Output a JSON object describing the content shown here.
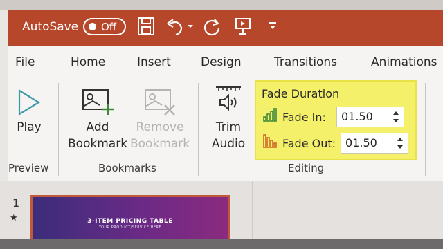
{
  "titlebar": {
    "autosave_label": "AutoSave",
    "autosave_state": "Off"
  },
  "tabs": [
    "File",
    "Home",
    "Insert",
    "Design",
    "Transitions",
    "Animations"
  ],
  "groups": {
    "preview": {
      "label": "Preview",
      "play_label": "Play"
    },
    "bookmarks": {
      "label": "Bookmarks",
      "add_line1": "Add",
      "add_line2": "Bookmark",
      "remove_line1": "Remove",
      "remove_line2": "Bookmark"
    },
    "editing": {
      "label": "Editing",
      "trim_line1": "Trim",
      "trim_line2": "Audio",
      "fade_title": "Fade Duration",
      "fade_in_label": "Fade In:",
      "fade_in_value": "01.50",
      "fade_out_label": "Fade Out:",
      "fade_out_value": "01.50"
    }
  },
  "slides": {
    "number": "1",
    "star": "★",
    "thumb_title": "3-ITEM PRICING TABLE",
    "thumb_subtitle": "YOUR PRODUCT/SERVICE HERE"
  },
  "colors": {
    "titlebar": "#b7472a",
    "highlight": "#f5f06a",
    "fade_icon_green": "#3f8a3a",
    "fade_icon_orange": "#d0662a",
    "slide_gradient_start": "#3b2d7a",
    "slide_gradient_end": "#8a2b7e"
  }
}
